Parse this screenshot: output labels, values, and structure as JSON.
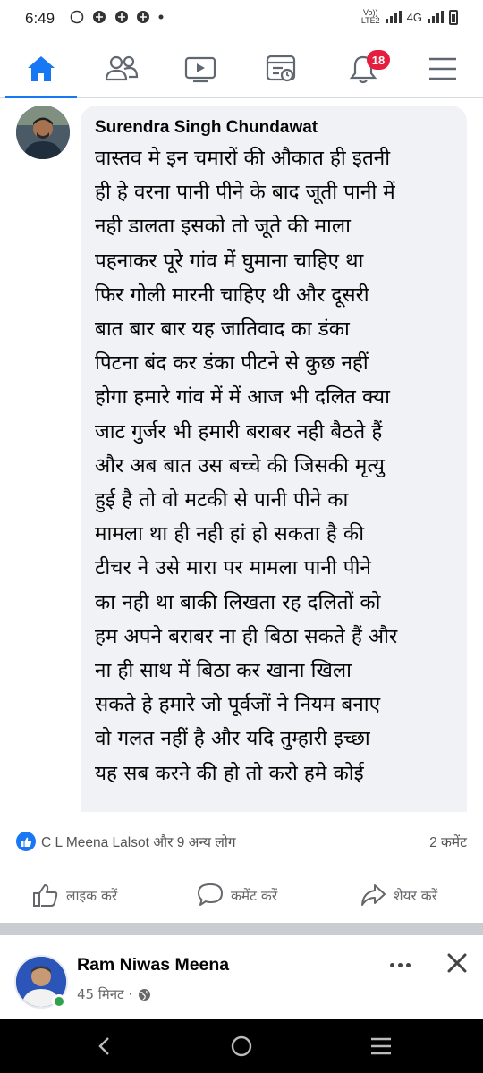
{
  "status_bar": {
    "time": "6:49",
    "network": "4G",
    "volte": "Vo))\nLTE2"
  },
  "nav": {
    "items": [
      {
        "name": "home",
        "active": true
      },
      {
        "name": "friends"
      },
      {
        "name": "watch"
      },
      {
        "name": "feeds"
      },
      {
        "name": "notifications"
      },
      {
        "name": "menu"
      }
    ],
    "notification_count": "18",
    "accent_color": "#1877f2",
    "badge_color": "#e41e3f"
  },
  "comment": {
    "author": "Surendra Singh Chundawat",
    "text": "वास्तव मे इन चमारों की औकात ही इतनी\nही हे वरना पानी पीने के बाद जूती पानी में\nनही डालता इसको तो जूते की माला\nपहनाकर पूरे गांव में घुमाना चाहिए था\nफिर गोली मारनी चाहिए थी और दूसरी\nबात बार बार यह जातिवाद का डंका\nपिटना बंद कर डंका पीटने से कुछ नहीं\nहोगा हमारे गांव में में आज भी दलित क्या\nजाट गुर्जर भी हमारी बराबर नही बैठते हैं\nऔर अब बात उस बच्चे की जिसकी मृत्यु\nहुई है तो वो मटकी से पानी पीने का\nमामला था ही नही हां हो सकता है की\nटीचर ने उसे मारा पर मामला पानी पीने\nका नही था बाकी लिखता रह दलितों को\nहम अपने बराबर ना ही बिठा सकते हैं और\nना ही साथ में बिठा कर खाना खिला\nसकते हे हमारे जो पूर्वजों ने नियम बनाए\nवो गलत नहीं है और यदि तुम्हारी इच्छा\nयह सब करने की हो तो करो हमे कोई"
  },
  "reactions": {
    "reactors": "C L Meena Lalsot और 9 अन्य लोग",
    "comments": "2 कमेंट"
  },
  "actions": {
    "like": "लाइक करें",
    "comment": "कमेंट करें",
    "share": "शेयर करें"
  },
  "next_post": {
    "author": "Ram Niwas Meena",
    "time": "45 मिनट ·",
    "audience_icon": "globe-icon"
  }
}
